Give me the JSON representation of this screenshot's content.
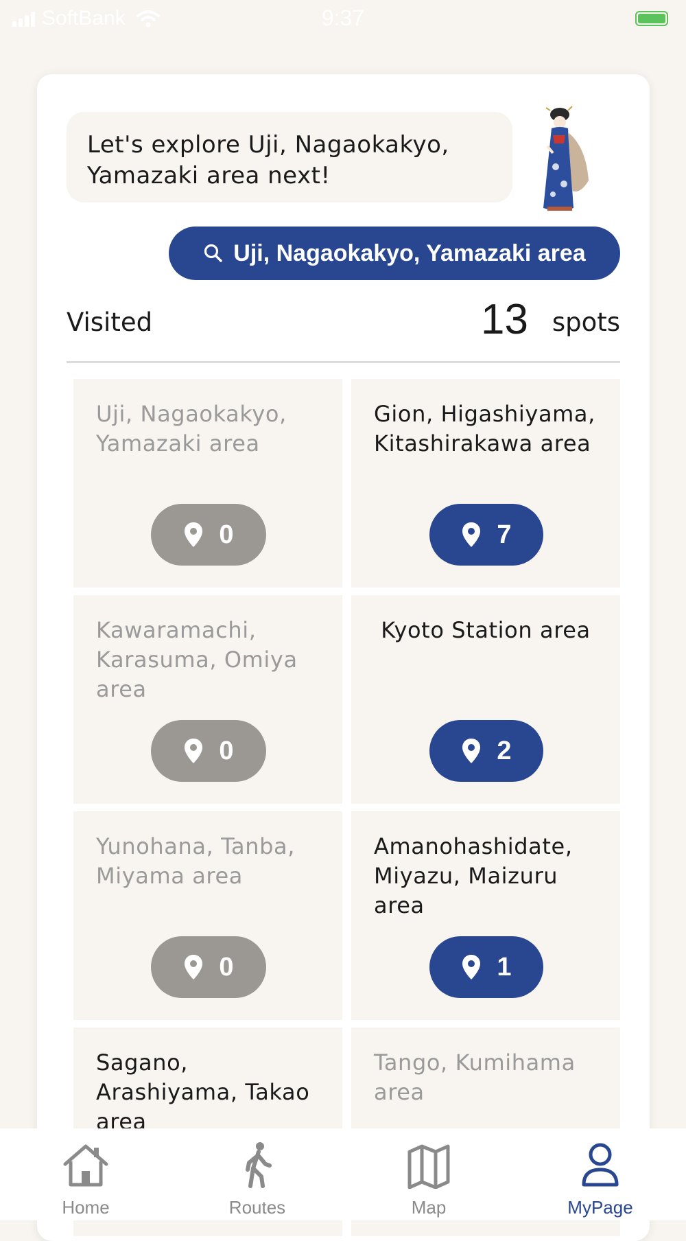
{
  "status_bar": {
    "carrier": "SoftBank",
    "time": "9:37"
  },
  "bubble": {
    "line1": "Let's explore Uji, Nagaokakyo,",
    "line2": "Yamazaki area next!"
  },
  "search": {
    "label": "Uji, Nagaokakyo, Yamazaki area"
  },
  "visited": {
    "label": "Visited",
    "count": "13",
    "unit": "spots"
  },
  "areas": [
    {
      "name": "Uji, Nagaokakyo, Yamazaki area",
      "count": "0",
      "active": false
    },
    {
      "name": "Gion, Higashiyama, Kitashirakawa area",
      "count": "7",
      "active": true
    },
    {
      "name": "Kawaramachi, Karasuma, Omiya area",
      "count": "0",
      "active": false
    },
    {
      "name": "Kyoto Station area",
      "count": "2",
      "active": true
    },
    {
      "name": "Yunohana, Tanba, Miyama area",
      "count": "0",
      "active": false
    },
    {
      "name": "Amanohashidate, Miyazu, Maizuru area",
      "count": "1",
      "active": true
    },
    {
      "name": "Sagano, Arashiyama, Takao area",
      "count": "",
      "active": true
    },
    {
      "name": "Tango, Kumihama area",
      "count": "",
      "active": false
    }
  ],
  "tabs": [
    {
      "label": "Home",
      "icon": "home-icon"
    },
    {
      "label": "Routes",
      "icon": "walking-person-icon"
    },
    {
      "label": "Map",
      "icon": "map-icon"
    },
    {
      "label": "MyPage",
      "icon": "person-icon"
    }
  ],
  "colors": {
    "accent": "#284790",
    "inactive_pill": "#9b9894",
    "background": "#f8f4ef"
  }
}
